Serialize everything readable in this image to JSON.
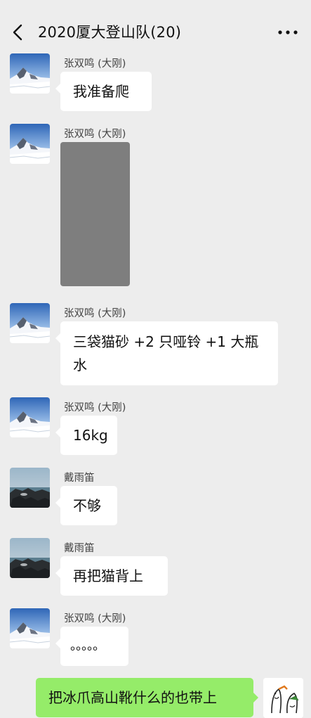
{
  "header": {
    "title": "2020厦大登山队(20)",
    "back_icon": "chevron-left-icon",
    "more_icon": "more-dots-icon"
  },
  "messages": [
    {
      "sender": "张双鸣 (大刚)",
      "text": "我准备爬",
      "avatar": "mountain-avatar"
    },
    {
      "sender": "张双鸣 (大刚)",
      "type": "image",
      "avatar": "mountain-avatar"
    },
    {
      "sender": "张双鸣 (大刚)",
      "lines": [
        "三袋猫砂 +2 只哑铃 +1 大瓶",
        "水"
      ],
      "avatar": "mountain-avatar"
    },
    {
      "sender": "张双鸣 (大刚)",
      "text": "16kg",
      "avatar": "mountain-avatar"
    },
    {
      "sender": "戴雨笛",
      "text": "不够",
      "avatar": "seashore-avatar"
    },
    {
      "sender": "戴雨笛",
      "text": "再把猫背上",
      "avatar": "seashore-avatar"
    },
    {
      "sender": "张双鸣 (大刚)",
      "text": "。。。。。",
      "avatar": "mountain-avatar"
    }
  ],
  "self_message": {
    "text": "把冰爪高山靴什么的也带上",
    "avatar": "sketch-avatar"
  },
  "colors": {
    "background": "#ededed",
    "bubble_incoming": "#ffffff",
    "bubble_outgoing": "#95ec69"
  }
}
